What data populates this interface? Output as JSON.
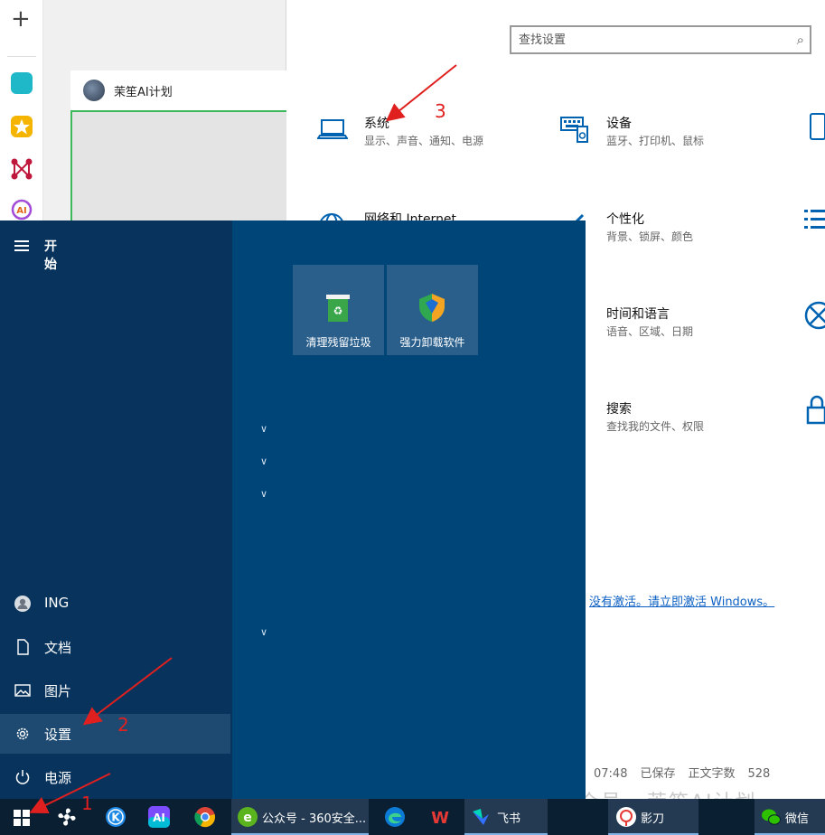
{
  "editor": {
    "author_name": "茉笙AI计划"
  },
  "launcher": {
    "icons": [
      "plus-icon",
      "app-icon-teal",
      "star-app-icon",
      "graph-app-icon",
      "ai-app-icon"
    ]
  },
  "settings": {
    "search_placeholder": "查找设置",
    "categories": [
      {
        "title": "系统",
        "subtitle": "显示、声音、通知、电源",
        "icon": "laptop-icon"
      },
      {
        "title": "设备",
        "subtitle": "蓝牙、打印机、鼠标",
        "icon": "keyboard-devices-icon"
      },
      {
        "title": "网络和 Internet",
        "subtitle": "",
        "icon": "globe-icon"
      },
      {
        "title": "个性化",
        "subtitle": "背景、锁屏、颜色",
        "icon": "brush-icon"
      },
      {
        "title": "时间和语言",
        "subtitle": "语音、区域、日期",
        "icon": "clock-language-icon"
      },
      {
        "title": "搜索",
        "subtitle": "查找我的文件、权限",
        "icon": "search-icon"
      }
    ],
    "activation_link": "没有激活。请立即激活 Windows。"
  },
  "editor_status": {
    "time": "07:48",
    "saved": "已保存",
    "word_count_label": "正文字数",
    "word_count": "528"
  },
  "watermark": "公众号 · 茉笙AI计划",
  "start_menu": {
    "header": "开始",
    "nav": [
      {
        "label": "ING",
        "icon": "user-icon"
      },
      {
        "label": "文档",
        "icon": "document-icon"
      },
      {
        "label": "图片",
        "icon": "pictures-icon"
      },
      {
        "label": "设置",
        "icon": "gear-icon"
      },
      {
        "label": "电源",
        "icon": "power-icon"
      }
    ],
    "tiles": [
      {
        "label": "清理残留垃圾",
        "icon": "recycle-bin-icon"
      },
      {
        "label": "强力卸载软件",
        "icon": "shield-uninstall-icon"
      }
    ]
  },
  "taskbar": {
    "items": [
      {
        "label": "",
        "icon": "windows-start-icon"
      },
      {
        "label": "",
        "icon": "fan-app-icon"
      },
      {
        "label": "",
        "icon": "k-app-icon"
      },
      {
        "label": "",
        "icon": "ai-app-icon"
      },
      {
        "label": "",
        "icon": "chrome-icon"
      },
      {
        "label": "公众号 - 360安全...",
        "icon": "360-browser-icon"
      },
      {
        "label": "",
        "icon": "edge-icon"
      },
      {
        "label": "",
        "icon": "wps-icon"
      },
      {
        "label": "飞书",
        "icon": "feishu-icon"
      },
      {
        "label": "影刀",
        "icon": "yingdao-icon"
      },
      {
        "label": "微信",
        "icon": "wechat-icon"
      }
    ]
  },
  "annotations": {
    "step1": "1",
    "step2": "2",
    "step3": "3"
  },
  "colors": {
    "start_left": "#07335c",
    "start_right": "#004578",
    "tile": "#2a5f8c",
    "settings_icon": "#0063b1",
    "annotation_red": "#e0201f",
    "link_blue": "#0b5fc2",
    "taskbar": "#0b1f33"
  }
}
